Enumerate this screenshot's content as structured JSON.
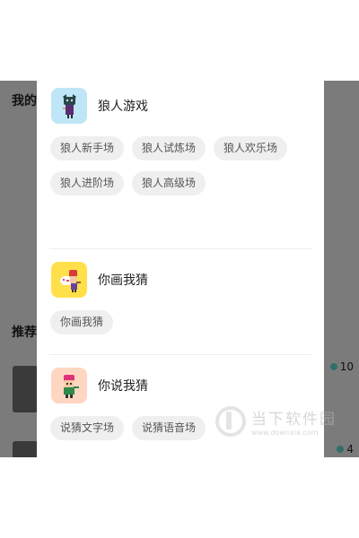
{
  "background": {
    "my_label": "我的",
    "recommend_label": "推荐",
    "count_1": "10",
    "count_2": "4"
  },
  "games": [
    {
      "title": "狼人游戏",
      "icon": "werewolf-icon",
      "modes": [
        "狼人新手场",
        "狼人试炼场",
        "狼人欢乐场",
        "狼人进阶场",
        "狼人高级场"
      ]
    },
    {
      "title": "你画我猜",
      "icon": "draw-guess-icon",
      "modes": [
        "你画我猜"
      ]
    },
    {
      "title": "你说我猜",
      "icon": "say-guess-icon",
      "modes": [
        "说猜文字场",
        "说猜语音场"
      ]
    }
  ],
  "watermark": {
    "name": "当下软件园",
    "url": "www.downxia.com"
  },
  "colors": {
    "overlay": "#7b7b7b",
    "tag_bg": "#efefef",
    "wolf_icon_bg": "#bfe6f6",
    "paint_icon_bg": "#ffe04a",
    "guess_icon_bg": "#ffd6c2"
  }
}
